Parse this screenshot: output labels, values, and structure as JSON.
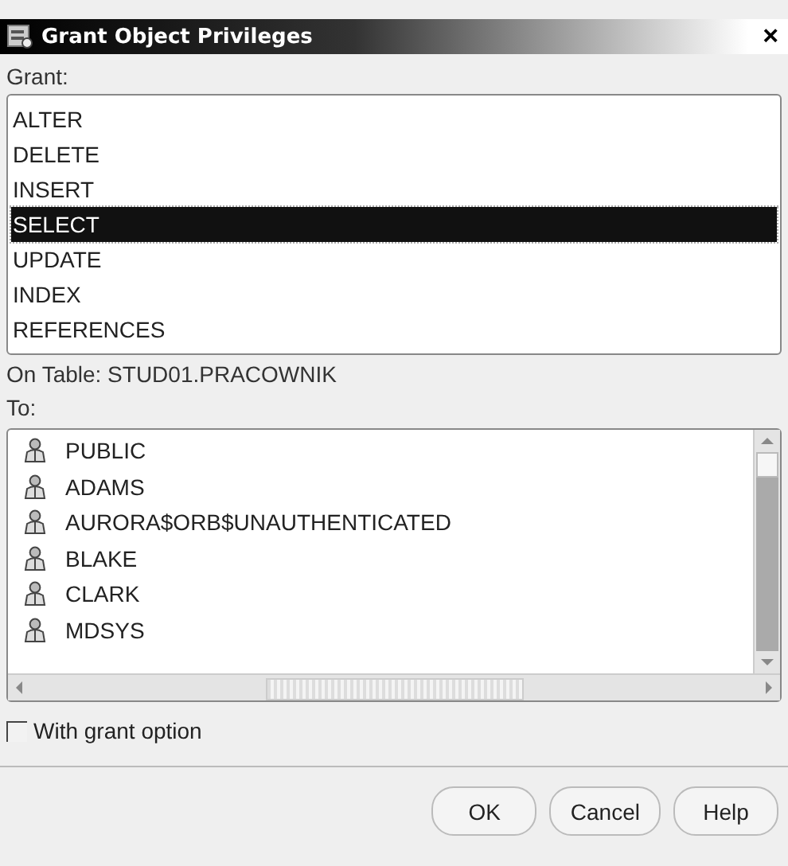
{
  "window": {
    "title": "Grant Object Privileges",
    "close": "×"
  },
  "grant": {
    "label": "Grant:",
    "items": [
      {
        "label": "ALTER",
        "selected": false
      },
      {
        "label": "DELETE",
        "selected": false
      },
      {
        "label": "INSERT",
        "selected": false
      },
      {
        "label": "SELECT",
        "selected": true
      },
      {
        "label": "UPDATE",
        "selected": false
      },
      {
        "label": "INDEX",
        "selected": false
      },
      {
        "label": "REFERENCES",
        "selected": false
      }
    ]
  },
  "on_table": "On Table: STUD01.PRACOWNIK",
  "to": {
    "label": "To:",
    "items": [
      "PUBLIC",
      "ADAMS",
      "AURORA$ORB$UNAUTHENTICATED",
      "BLAKE",
      "CLARK",
      "MDSYS"
    ]
  },
  "with_grant_option": {
    "label": "With grant option",
    "checked": false
  },
  "buttons": [
    "OK",
    "Cancel",
    "Help"
  ]
}
